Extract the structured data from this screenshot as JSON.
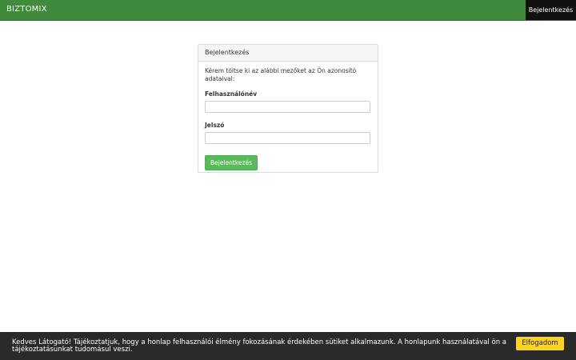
{
  "navbar": {
    "brand": "BIZTOMIX",
    "login_label": "Bejelentkezés"
  },
  "login_panel": {
    "heading": "Bejelentkezés",
    "intro": "Kérem töltse ki az alábbi mezőket az Ön azonosító adataival:",
    "username_label": "Felhasználónév",
    "username_value": "",
    "password_label": "Jelszó",
    "password_value": "",
    "submit_label": "Bejelentkezés"
  },
  "cookie_bar": {
    "text": "Kedves Látogató! Tájékoztatjuk, hogy a honlap felhasználói élmény fokozásának érdekében sütiket alkalmazunk. A honlapunk használatával ön a tájékoztatásunkat tudomásul veszi.",
    "accept_label": "Elfogadom"
  },
  "colors": {
    "navbar": "#3f8a3c",
    "button": "#5cb85c",
    "cookie_button": "#ffd21f"
  }
}
